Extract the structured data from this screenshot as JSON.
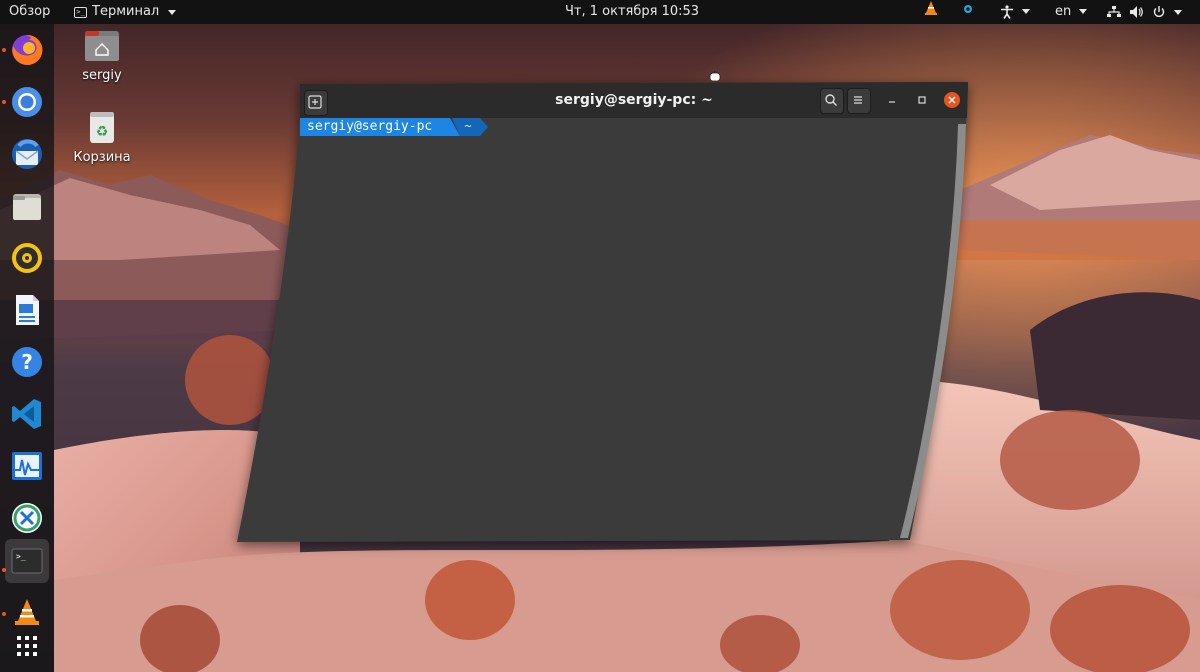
{
  "topbar": {
    "activities_label": "Обзор",
    "app_menu_label": "Терминал",
    "clock": "Чт, 1 октября  10:53",
    "keyboard_layout": "en"
  },
  "dock": {
    "items": [
      {
        "name": "firefox-icon",
        "running": true
      },
      {
        "name": "chromium-icon",
        "running": true
      },
      {
        "name": "thunderbird-icon",
        "running": false
      },
      {
        "name": "files-icon",
        "running": false
      },
      {
        "name": "rhythmbox-icon",
        "running": false
      },
      {
        "name": "libreoffice-writer-icon",
        "running": false
      },
      {
        "name": "help-icon",
        "running": false
      },
      {
        "name": "vscode-icon",
        "running": false
      },
      {
        "name": "system-monitor-icon",
        "running": false
      },
      {
        "name": "crossover-icon",
        "running": false
      },
      {
        "name": "terminal-icon",
        "running": true
      },
      {
        "name": "vlc-icon",
        "running": true
      },
      {
        "name": "show-applications-icon",
        "running": false
      }
    ]
  },
  "desktop": {
    "icons": [
      {
        "label": "sergiy",
        "icon": "home-folder-icon"
      },
      {
        "label": "Корзина",
        "icon": "trash-icon"
      }
    ]
  },
  "terminal": {
    "title": "sergiy@sergiy-pc: ~",
    "prompt_user": "sergiy@sergiy-pc",
    "prompt_dir": "~"
  },
  "colors": {
    "topbar": "#121212",
    "terminal_bg": "#3a3a3a",
    "prompt_accent": "#1c86e2",
    "close_button": "#e95420"
  }
}
